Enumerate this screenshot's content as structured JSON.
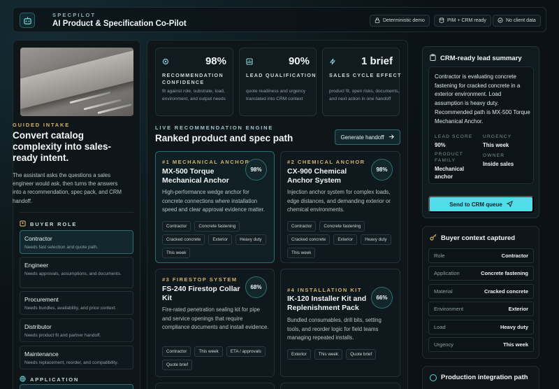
{
  "header": {
    "kicker": "SPECPILOT",
    "title": "AI Product & Specification Co-Pilot",
    "badges": [
      "Deterministic demo",
      "PIM + CRM ready",
      "No client data"
    ]
  },
  "intake": {
    "kicker": "GUIDED INTAKE",
    "title": "Convert catalog complexity into sales-ready intent.",
    "body": "The assistant asks the questions a sales engineer would ask, then turns the answers into a recommendation, spec pack, and CRM handoff."
  },
  "buyer_role": {
    "label": "BUYER ROLE",
    "items": [
      {
        "name": "Contractor",
        "desc": "Needs fast selection and quote path."
      },
      {
        "name": "Engineer",
        "desc": "Needs approvals, assumptions, and documents."
      },
      {
        "name": "Procurement",
        "desc": "Needs bundles, availability, and price context."
      },
      {
        "name": "Distributor",
        "desc": "Needs product fit and partner handoff."
      },
      {
        "name": "Maintenance",
        "desc": "Needs replacement, reorder, and compatibility."
      }
    ]
  },
  "application": {
    "label": "APPLICATION"
  },
  "metrics": [
    {
      "value": "98%",
      "label": "RECOMMENDATION CONFIDENCE",
      "desc": "fit against role, substrate, load, environment, and output needs"
    },
    {
      "value": "90%",
      "label": "LEAD QUALIFICATION",
      "desc": "quote readiness and urgency translated into CRM context"
    },
    {
      "value": "1 brief",
      "label": "SALES CYCLE EFFECT",
      "desc": "product fit, open risks, documents, and next action in one handoff"
    }
  ],
  "engine": {
    "kicker": "LIVE RECOMMENDATION ENGINE",
    "title": "Ranked product and spec path",
    "button": "Generate handoff"
  },
  "products": [
    {
      "kicker": "#1 MECHANICAL ANCHOR",
      "name": "MX-500 Torque Mechanical Anchor",
      "score": "98%",
      "desc": "High-performance wedge anchor for concrete connections where installation speed and clear approval evidence matter.",
      "tags": [
        "Contractor",
        "Concrete fastening",
        "Cracked concrete",
        "Exterior",
        "Heavy duty",
        "This week"
      ]
    },
    {
      "kicker": "#2 CHEMICAL ANCHOR",
      "name": "CX-900 Chemical Anchor System",
      "score": "98%",
      "desc": "Injection anchor system for complex loads, edge distances, and demanding exterior or chemical environments.",
      "tags": [
        "Contractor",
        "Concrete fastening",
        "Cracked concrete",
        "Exterior",
        "Heavy duty",
        "This week"
      ]
    },
    {
      "kicker": "#3 FIRESTOP SYSTEM",
      "name": "FS-240 Firestop Collar Kit",
      "score": "68%",
      "desc": "Fire-rated penetration sealing kit for pipe and service openings that require compliance documents and install evidence.",
      "tags": [
        "Contractor",
        "This week",
        "ETA / approvals",
        "Quote brief"
      ]
    },
    {
      "kicker": "#4 INSTALLATION KIT",
      "name": "IK-120 Installer Kit and Replenishment Pack",
      "score": "66%",
      "desc": "Bundled consumables, drill bits, setting tools, and reorder logic for field teams managing repeated installs.",
      "tags": [
        "Exterior",
        "This week",
        "Quote brief"
      ]
    }
  ],
  "crm": {
    "title": "CRM-ready lead summary",
    "summary": "Contractor is evaluating concrete fastening for cracked concrete in a exterior environment. Load assumption is heavy duty. Recommended path is MX-500 Torque Mechanical Anchor.",
    "fields": [
      {
        "key": "LEAD SCORE",
        "value": "90%"
      },
      {
        "key": "URGENCY",
        "value": "This week"
      },
      {
        "key": "PRODUCT FAMILY",
        "value": "Mechanical anchor"
      },
      {
        "key": "OWNER",
        "value": "Inside sales"
      }
    ],
    "button": "Send to CRM queue"
  },
  "context": {
    "title": "Buyer context captured",
    "rows": [
      {
        "key": "Role",
        "value": "Contractor"
      },
      {
        "key": "Application",
        "value": "Concrete fastening"
      },
      {
        "key": "Material",
        "value": "Cracked concrete"
      },
      {
        "key": "Environment",
        "value": "Exterior"
      },
      {
        "key": "Load",
        "value": "Heavy duty"
      },
      {
        "key": "Urgency",
        "value": "This week"
      }
    ]
  },
  "production": {
    "title": "Production integration path"
  },
  "colors": {
    "accent": "#50dde9",
    "gold": "#d4b26a",
    "bg": "#0b1114"
  }
}
